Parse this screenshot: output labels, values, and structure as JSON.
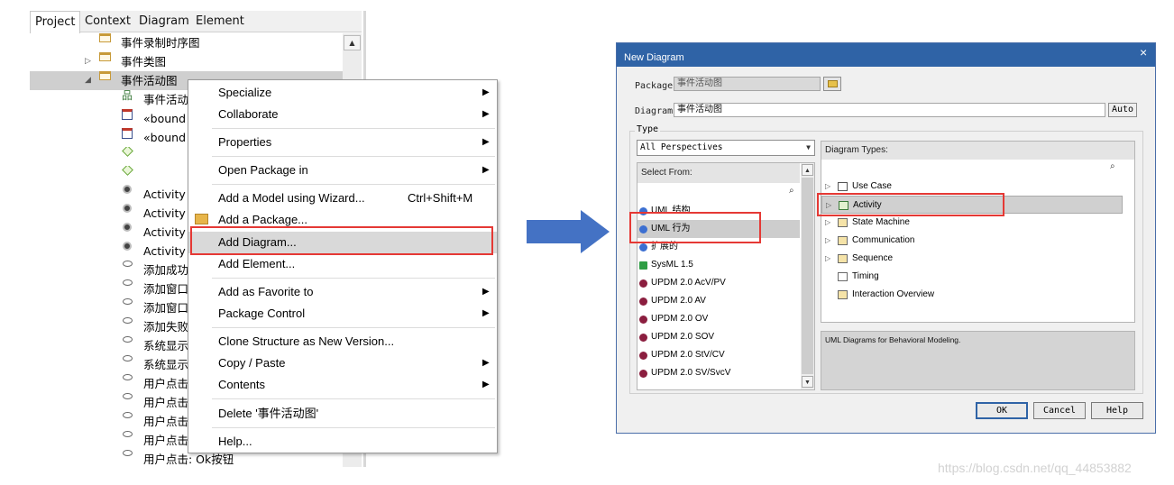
{
  "left": {
    "tabs": [
      "Project",
      "Context",
      "Diagram",
      "Element"
    ],
    "tree": [
      {
        "label": "事件录制时序图",
        "icon": "folder"
      },
      {
        "label": "事件类图",
        "icon": "folder",
        "expander": "▷"
      },
      {
        "label": "事件活动图",
        "icon": "folder",
        "expander": "◢",
        "selected": true
      },
      {
        "label": "事件活动",
        "icon": "activity-diagram"
      },
      {
        "label": "«bound",
        "icon": "boundary"
      },
      {
        "label": "«bound",
        "icon": "boundary"
      },
      {
        "label": "",
        "icon": "decision"
      },
      {
        "label": "",
        "icon": "decision"
      },
      {
        "label": "Activity",
        "icon": "activity-node"
      },
      {
        "label": "Activity",
        "icon": "activity-node"
      },
      {
        "label": "Activity",
        "icon": "activity-node"
      },
      {
        "label": "Activity",
        "icon": "activity-node"
      },
      {
        "label": "添加成功",
        "icon": "action"
      },
      {
        "label": "添加窗口",
        "icon": "action"
      },
      {
        "label": "添加窗口",
        "icon": "action"
      },
      {
        "label": "添加失败",
        "icon": "action"
      },
      {
        "label": "系统显示",
        "icon": "action"
      },
      {
        "label": "系统显示",
        "icon": "action"
      },
      {
        "label": "用户点击",
        "icon": "action"
      },
      {
        "label": "用户点击",
        "icon": "action"
      },
      {
        "label": "用户点击",
        "icon": "action"
      },
      {
        "label": "用户点击",
        "icon": "action"
      },
      {
        "label": "用户点击: Ok按钮",
        "icon": "action"
      }
    ],
    "context_menu": [
      {
        "label": "Specialize",
        "submenu": true
      },
      {
        "label": "Collaborate",
        "submenu": true
      },
      {
        "label": "Properties",
        "submenu": true
      },
      {
        "label": "Open Package in",
        "submenu": true
      },
      {
        "label": "Add a Model using Wizard...",
        "shortcut": "Ctrl+Shift+M"
      },
      {
        "label": "Add a Package..."
      },
      {
        "label": "Add Diagram...",
        "highlighted": true
      },
      {
        "label": "Add Element..."
      },
      {
        "label": "Add as Favorite to",
        "submenu": true
      },
      {
        "label": "Package Control",
        "submenu": true
      },
      {
        "label": "Clone Structure as New Version..."
      },
      {
        "label": "Copy / Paste",
        "submenu": true
      },
      {
        "label": "Contents",
        "submenu": true
      },
      {
        "label": "Delete '事件活动图'"
      },
      {
        "label": "Help..."
      }
    ]
  },
  "dialog": {
    "title": "New Diagram",
    "close": "×",
    "package_label": "Package",
    "package_value": "事件活动图",
    "diagram_label": "Diagram",
    "diagram_value": "事件活动图",
    "auto_button": "Auto",
    "type_group": "Type",
    "perspective": "All Perspectives",
    "select_from_header": "Select From:",
    "select_from": [
      {
        "label": "UML 结构",
        "color": "#3c6fd1"
      },
      {
        "label": "UML 行为",
        "color": "#3c6fd1",
        "selected": true
      },
      {
        "label": "扩展的",
        "color": "#3c6fd1"
      },
      {
        "label": "SysML 1.5",
        "color": "#2e9e44"
      },
      {
        "label": "UPDM 2.0 AcV/PV",
        "color": "#8b1e3f"
      },
      {
        "label": "UPDM 2.0 AV",
        "color": "#8b1e3f"
      },
      {
        "label": "UPDM 2.0 OV",
        "color": "#8b1e3f"
      },
      {
        "label": "UPDM 2.0 SOV",
        "color": "#8b1e3f"
      },
      {
        "label": "UPDM 2.0 StV/CV",
        "color": "#8b1e3f"
      },
      {
        "label": "UPDM 2.0 SV/SvcV",
        "color": "#8b1e3f"
      }
    ],
    "types_header": "Diagram Types:",
    "diagram_types": [
      {
        "label": "Use Case",
        "expander": true
      },
      {
        "label": "Activity",
        "expander": true,
        "selected": true
      },
      {
        "label": "State Machine",
        "expander": true
      },
      {
        "label": "Communication",
        "expander": true
      },
      {
        "label": "Sequence",
        "expander": true
      },
      {
        "label": "Timing",
        "expander": false
      },
      {
        "label": "Interaction Overview",
        "expander": false
      }
    ],
    "description": "UML Diagrams for Behavioral Modeling.",
    "buttons": {
      "ok": "OK",
      "cancel": "Cancel",
      "help": "Help"
    }
  },
  "watermark": "https://blog.csdn.net/qq_44853882",
  "colors": {
    "highlight_box": "#e53935",
    "arrow": "#4472c4",
    "title_bar": "#2f63a6"
  }
}
